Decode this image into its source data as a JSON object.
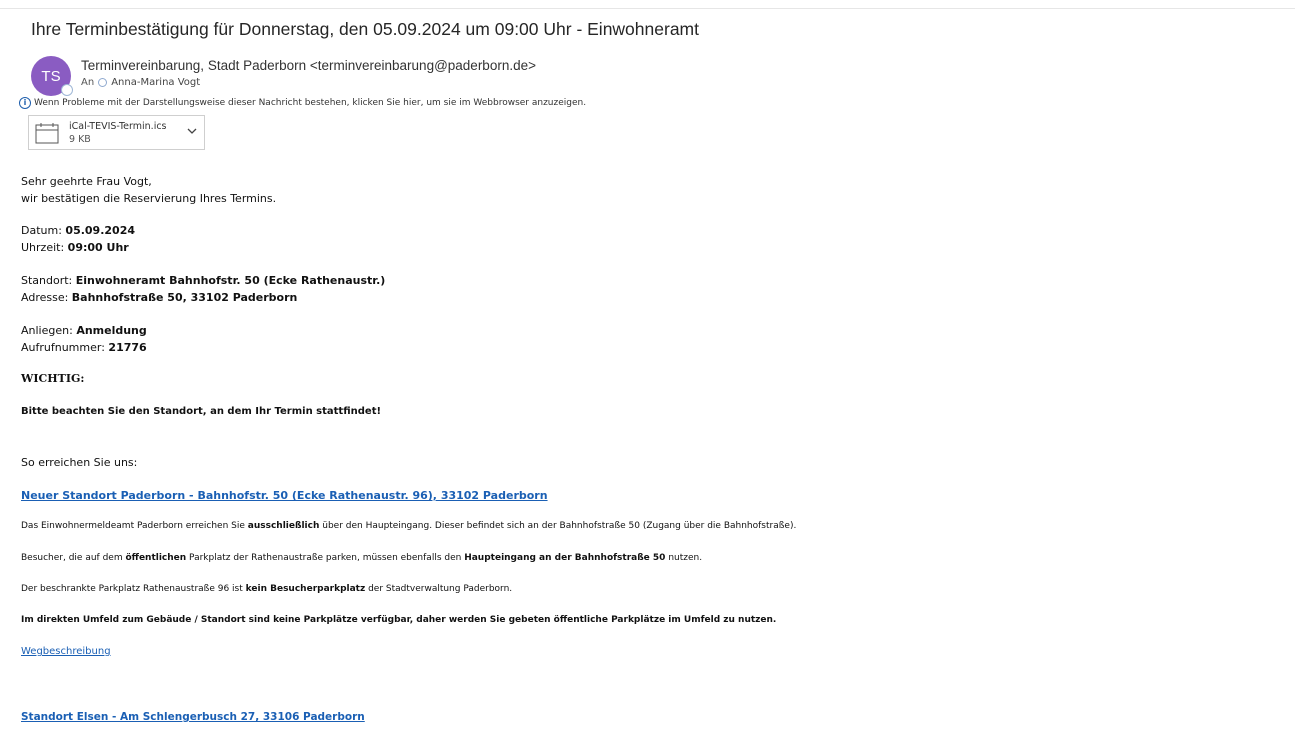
{
  "email": {
    "subject": "Ihre Terminbestätigung für Donnerstag, den 05.09.2024 um 09:00 Uhr - Einwohneramt",
    "avatar_initials": "TS",
    "sender": "Terminvereinbarung, Stadt Paderborn <terminvereinbarung@paderborn.de>",
    "to_label": "An",
    "recipient": "Anna-Marina Vogt",
    "info_bar": "Wenn Probleme mit der Darstellungsweise dieser Nachricht bestehen, klicken Sie hier, um sie im Webbrowser anzuzeigen.",
    "attachment": {
      "name": "iCal-TEVIS-Termin.ics",
      "size": "9 KB"
    }
  },
  "body": {
    "greeting": "Sehr geehrte Frau Vogt,",
    "intro": "wir bestätigen die Reservierung Ihres Termins.",
    "datum_label": "Datum: ",
    "datum_value": "05.09.2024",
    "uhrzeit_label": "Uhrzeit: ",
    "uhrzeit_value": "09:00 Uhr",
    "standort_label": "Standort: ",
    "standort_value": "Einwohneramt Bahnhofstr. 50 (Ecke Rathenaustr.)",
    "adresse_label": "Adresse: ",
    "adresse_value": "Bahnhofstraße 50, 33102 Paderborn",
    "anliegen_label": "Anliegen: ",
    "anliegen_value": "Anmeldung",
    "aufruf_label": "Aufrufnummer: ",
    "aufruf_value": "21776",
    "wichtig": "WICHTIG:",
    "beachten": "Bitte beachten Sie den Standort, an dem Ihr Termin stattfindet!",
    "so_erreichen": "So erreichen Sie uns:",
    "link_neuer_standort": "Neuer Standort Paderborn - Bahnhofstr. 50 (Ecke Rathenaustr. 96), 33102 Paderborn",
    "p1_a": "Das Einwohnermeldeamt Paderborn erreichen Sie ",
    "p1_b": "ausschließlich",
    "p1_c": " über den Haupteingang. Dieser befindet sich an der Bahnhofstraße 50 (Zugang über die Bahnhofstraße).",
    "p2_a": "Besucher, die auf dem ",
    "p2_b": "öffentlichen",
    "p2_c": " Parkplatz der Rathenaustraße parken, müssen ebenfalls den ",
    "p2_d": "Haupteingang an der Bahnhofstraße 50",
    "p2_e": " nutzen.",
    "p3_a": "Der beschrankte Parkplatz Rathenaustraße 96 ist ",
    "p3_b": "kein Besucherparkplatz",
    "p3_c": " der Stadtverwaltung Paderborn.",
    "p4": "Im direkten Umfeld zum Gebäude / Standort sind keine Parkplätze verfügbar, daher werden Sie gebeten öffentliche Parkplätze im Umfeld zu nutzen.",
    "link_weg": "Wegbeschreibung",
    "link_elsen": "Standort Elsen - Am Schlengerbusch 27, 33106 Paderborn"
  }
}
